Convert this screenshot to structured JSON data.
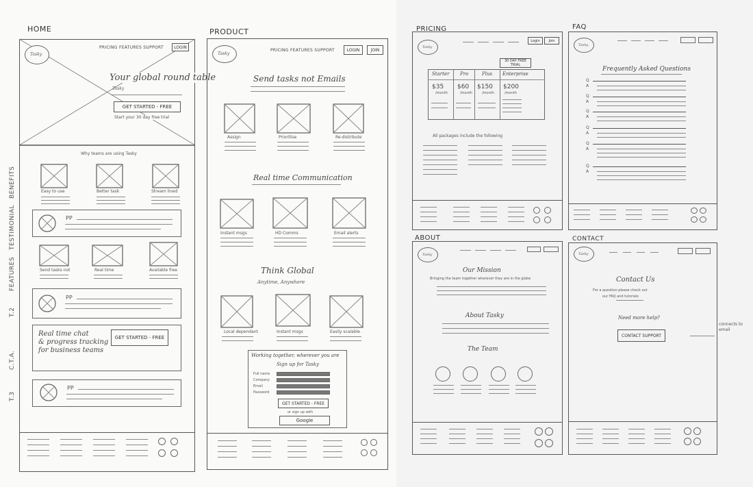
{
  "pages": {
    "home": "HOME",
    "product": "PRODUCT",
    "pricing": "PRICING",
    "faq": "FAQ",
    "about": "ABOUT",
    "contact": "CONTACT"
  },
  "brand": "Tasky",
  "home": {
    "nav": "PRICING  FEATURES  SUPPORT",
    "login": "LOGIN",
    "hero_title": "Your global round table",
    "hero_sub": "Tasky",
    "cta": "GET STARTED - FREE",
    "cta_note": "Start your 30 day free trial",
    "benefits_title": "Why teams are using Tasky",
    "benefits": [
      "Easy to use",
      "Better task",
      "Stream lined"
    ],
    "features": [
      "Send tasks not",
      "Real time",
      "Available free"
    ],
    "pp": "PP",
    "cta_block_text": "Real time chat\n& progress tracking\nfor business teams",
    "cta_block_btn": "GET STARTED - FREE",
    "side_labels": [
      "BENEFITS",
      "TESTIMONIAL",
      "FEATURES",
      "T.2",
      "C.T.A.",
      "T.3"
    ]
  },
  "product": {
    "nav": "PRICING  FEATURES  SUPPORT",
    "login": "LOGIN",
    "join": "JOIN",
    "h1": "Send tasks not Emails",
    "r1": [
      "Assign",
      "Prioritise",
      "Re-distribute"
    ],
    "h2": "Real time Communication",
    "r2": [
      "Instant msgs",
      "HD Comms",
      "Email alerts"
    ],
    "h3": "Think Global",
    "h3_sub": "Anytime, Anywhere",
    "r3": [
      "Local dependant",
      "Instant msgs",
      "Easily scalable"
    ],
    "signup_title": "Working together, wherever you are",
    "signup_sub": "Sign up for Tasky",
    "fields": [
      "Full name",
      "Company",
      "Email",
      "Password"
    ],
    "signup_btn": "GET STARTED - FREE",
    "or_text": "or sign up with",
    "google": "Google"
  },
  "pricing": {
    "login": "Login",
    "join": "Join",
    "trial": "30 DAY FREE TRIAL",
    "plans": [
      "Starter",
      "Pro",
      "Plus",
      "Enterprise"
    ],
    "prices": [
      "$35",
      "$60",
      "$150",
      "$200"
    ],
    "per": [
      "/month",
      "/month",
      "/month",
      "/month"
    ],
    "packages_note": "All packages include the following"
  },
  "faq": {
    "title": "Frequently Asked Questions",
    "q": "Q",
    "a": "A"
  },
  "about": {
    "mission": "Our Mission",
    "mission_text": "Bringing the team together wherever they are in the globe",
    "about": "About Tasky",
    "team": "The Team"
  },
  "contact": {
    "title": "Contact Us",
    "text1": "For a question please check out",
    "text2": "our FAQ and tutorials",
    "need_help": "Need more help?",
    "btn": "CONTACT SUPPORT",
    "annot": "connects to email"
  }
}
